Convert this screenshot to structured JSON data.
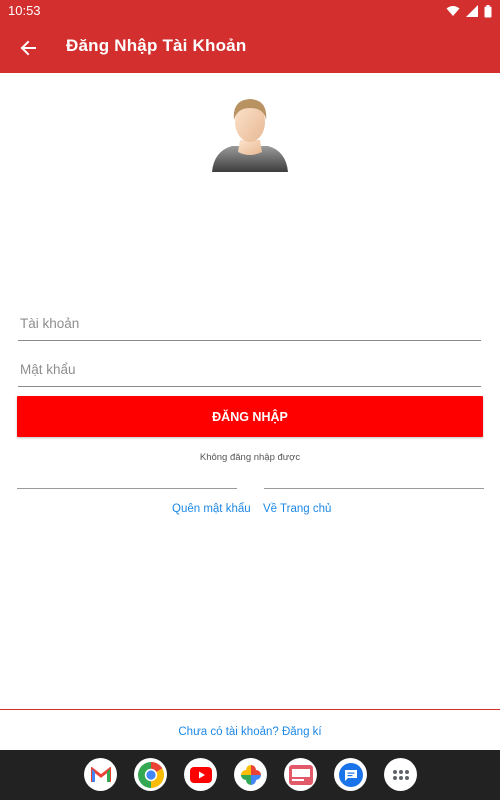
{
  "status_bar": {
    "time": "10:53"
  },
  "app_bar": {
    "title": "Đăng Nhập Tài Khoản"
  },
  "form": {
    "username_placeholder": "Tài khoản",
    "password_placeholder": "Mật khẩu",
    "login_button": "ĐĂNG NHẬP",
    "login_problem": "Không đăng nhập được"
  },
  "links": {
    "forgot_password": "Quên mật khẩu",
    "home": "Về Trang chủ",
    "register": "Chưa có tài khoản? Đăng kí"
  },
  "colors": {
    "primary": "#D32F2F",
    "button": "#FF0000",
    "link": "#1E88E5"
  },
  "dock": {
    "apps": [
      "gmail-icon",
      "chrome-icon",
      "youtube-icon",
      "photos-icon",
      "news-app-icon",
      "messages-icon",
      "app-drawer-icon"
    ]
  }
}
